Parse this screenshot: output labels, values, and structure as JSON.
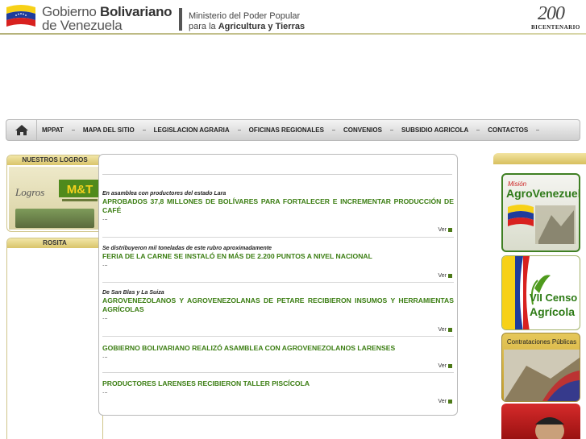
{
  "header": {
    "gov_line1_a": "Gobierno",
    "gov_line1_b": "Bolivariano",
    "gov_line2": "de Venezuela",
    "ministry_line1": "Ministerio del Poder Popular",
    "ministry_line2_a": "para la",
    "ministry_line2_b": "Agricultura y Tierras",
    "bicentenario_number": "200",
    "bicentenario_text": "BICENTENARIO"
  },
  "nav": {
    "home_icon": "home-icon",
    "items": [
      {
        "label": "MPPAT"
      },
      {
        "label": "MAPA DEL SITIO"
      },
      {
        "label": "LEGISLACION AGRARIA"
      },
      {
        "label": "OFICINAS REGIONALES"
      },
      {
        "label": "CONVENIOS"
      },
      {
        "label": "SUBSIDIO AGRICOLA"
      },
      {
        "label": "CONTACTOS"
      }
    ]
  },
  "left": {
    "logros_header": "NUESTROS LOGROS",
    "logros_word": "Logros",
    "logros_mat": "M&T",
    "rosita_header": "ROSITA"
  },
  "news": {
    "more_label": "Ver",
    "items": [
      {
        "subtitle": "En asamblea con productores del estado Lara",
        "title": "APROBADOS 37,8 MILLONES DE BOLÍVARES PARA FORTALECER E INCREMENTAR PRODUCCIÓN DE CAFÉ",
        "dots": "..."
      },
      {
        "subtitle": "Se distribuyeron mil toneladas de este rubro aproximadamente",
        "title": "FERIA DE LA CARNE SE INSTALÓ EN MÁS DE 2.200 PUNTOS A NIVEL NACIONAL",
        "dots": "..."
      },
      {
        "subtitle": "De San Blas y La Suiza",
        "title": "AGROVENEZOLANOS Y AGROVENEZOLANAS DE PETARE RECIBIERON INSUMOS Y HERRAMIENTAS AGRÍCOLAS",
        "dots": "..."
      },
      {
        "subtitle": "",
        "title": "GOBIERNO BOLIVARIANO REALIZÓ ASAMBLEA CON AGROVENEZOLANOS LARENSES",
        "dots": "..."
      },
      {
        "subtitle": "",
        "title": "PRODUCTORES LARENSES RECIBIERON TALLER PISCÍCOLA",
        "dots": "..."
      }
    ]
  },
  "right": {
    "agro_small": "Misión",
    "agro_big": "AgroVenezuela",
    "censo_line1": "VII Censo",
    "censo_line2": "Agrícola",
    "contrataciones": "Contrataciones Públicas"
  }
}
